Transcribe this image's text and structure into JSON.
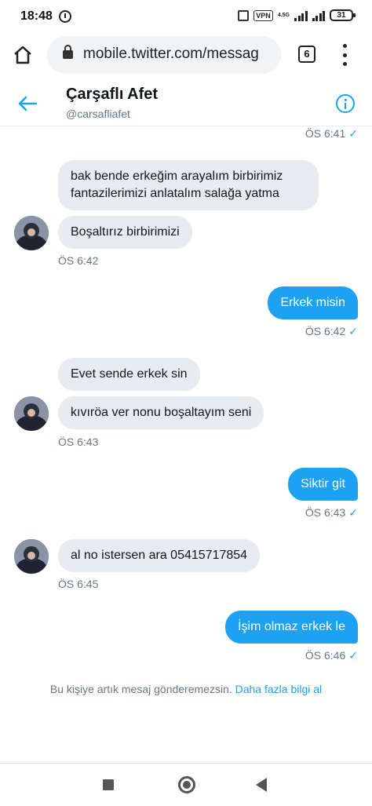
{
  "status_bar": {
    "time": "18:48",
    "vpn": "VPN",
    "network": "4.5G",
    "battery": "31"
  },
  "browser": {
    "url": "mobile.twitter.com/messag",
    "tab_count": "6"
  },
  "conversation": {
    "name": "Çarşaflı Afet",
    "handle": "@carsafliafet"
  },
  "messages": [
    {
      "direction": "out",
      "text": "",
      "time": "ÖS 6:41",
      "seen": true
    },
    {
      "direction": "in",
      "text": "bak bende erkeğim arayalım birbirimiz fantazilerimizi anlatalım salağa yatma"
    },
    {
      "direction": "in",
      "text": "Boşaltırız birbirimizi",
      "time": "ÖS 6:42"
    },
    {
      "direction": "out",
      "text": "Erkek misin",
      "time": "ÖS 6:42",
      "seen": true
    },
    {
      "direction": "in",
      "text": "Evet sende erkek sin"
    },
    {
      "direction": "in",
      "text": "kıvıröa ver nonu boşaltayım seni",
      "time": "ÖS 6:43"
    },
    {
      "direction": "out",
      "text": "Siktir git",
      "time": "ÖS 6:43",
      "seen": true
    },
    {
      "direction": "in",
      "text": "al no istersen ara 05415717854",
      "time": "ÖS 6:45"
    },
    {
      "direction": "out",
      "text": "İşim olmaz erkek le",
      "time": "ÖS 6:46",
      "seen": true
    }
  ],
  "notice": {
    "text": "Bu kişiye artık mesaj gönderemezsin.",
    "link": "Daha fazla bilgi al"
  },
  "colors": {
    "accent": "#1da1f2",
    "incoming_bubble": "#e6ecf0"
  }
}
